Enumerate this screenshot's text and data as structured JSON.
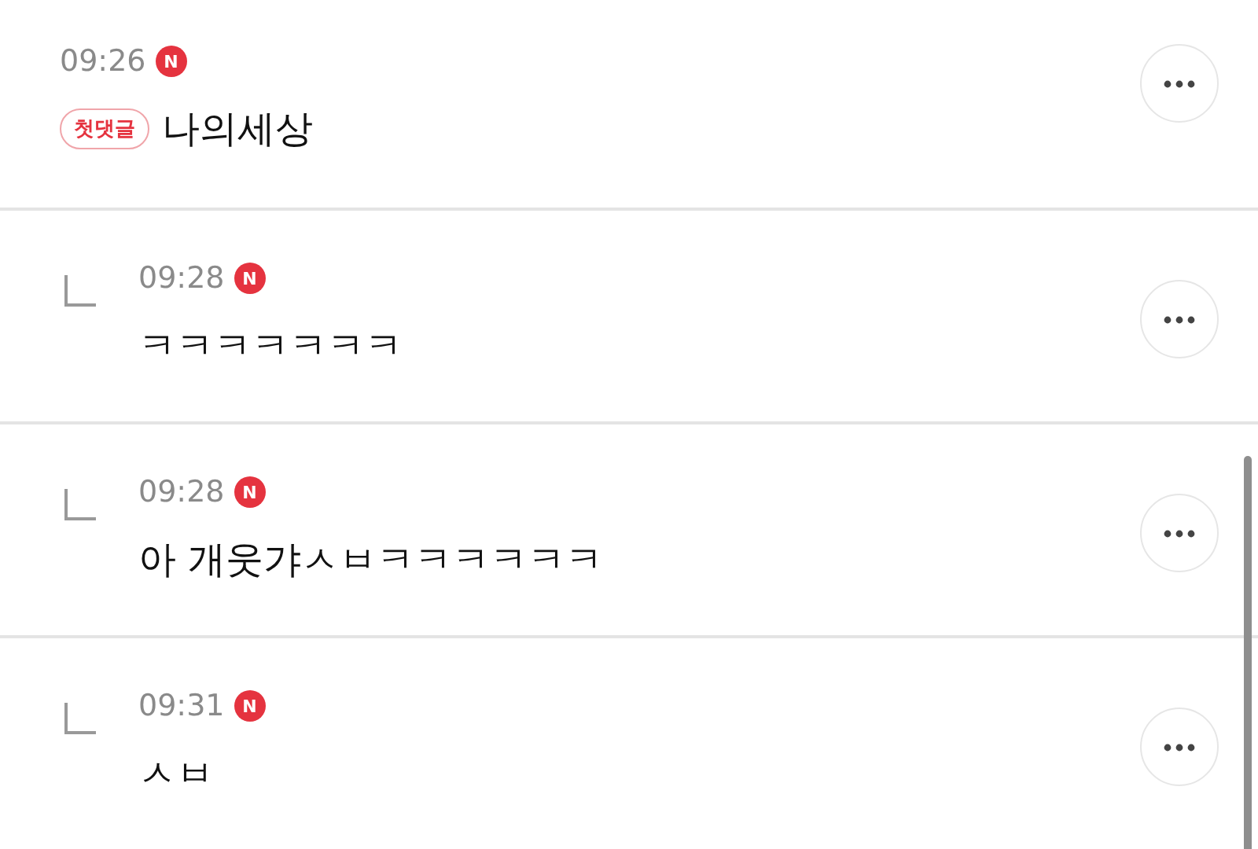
{
  "comments": [
    {
      "kind": "comment",
      "time": "09:26",
      "new_badge": "N",
      "first_badge": "첫댓글",
      "text": "나의세상"
    },
    {
      "kind": "reply",
      "time": "09:28",
      "new_badge": "N",
      "text": "ㅋㅋㅋㅋㅋㅋㅋ"
    },
    {
      "kind": "reply",
      "time": "09:28",
      "new_badge": "N",
      "text": "아 개웃갸ㅅㅂㅋㅋㅋㅋㅋㅋ"
    },
    {
      "kind": "reply",
      "time": "09:31",
      "new_badge": "N",
      "text": "ㅅㅂ"
    }
  ]
}
